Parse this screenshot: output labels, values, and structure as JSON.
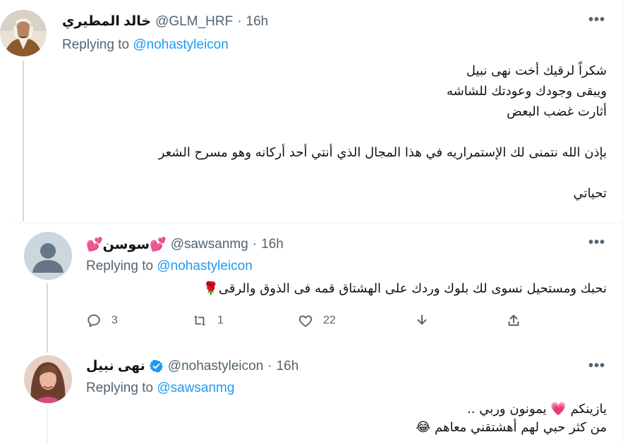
{
  "colors": {
    "link": "#1d9bf0",
    "secondary": "#536471",
    "verified": "#1d9bf0",
    "heart_emoji": "#e0245e"
  },
  "tweets": [
    {
      "name": "خالد المطيري",
      "handle": "@GLM_HRF",
      "time": "16h",
      "replying_label": "Replying to",
      "replying_to": "@nohastyleicon",
      "more_icon": "more-horizontal-icon",
      "lines": [
        "شكراً لرقيك أخت نهى نبيل",
        "ويبقى وجودك وعودتك للشاشه",
        "أثارت غضب البعض",
        "",
        "بإذن الله نتمنى لك الإستمراريه في هذا المجال الذي أنتي أحد أركانه وهو مسرح الشعر",
        "",
        "تحياتي"
      ]
    },
    {
      "name": "💕سوسن💕",
      "handle": "@sawsanmg",
      "time": "16h",
      "replying_label": "Replying to",
      "replying_to": "@nohastyleicon",
      "text": "نحبك ومستحيل نسوى لك بلوك وردك على الهشتاق قمه فى الذوق والرقى🌹",
      "actions": {
        "replies": "3",
        "retweets": "1",
        "likes": "22"
      }
    },
    {
      "name": "نهى نبيل",
      "handle": "@nohastyleicon",
      "time": "16h",
      "verified": true,
      "replying_label": "Replying to",
      "replying_to": "@sawsanmg",
      "lines": [
        "يازينكم 💗 يمونون وربي ..",
        "من كثر حبي لهم أهشتقني معاهم 😂"
      ]
    }
  ]
}
